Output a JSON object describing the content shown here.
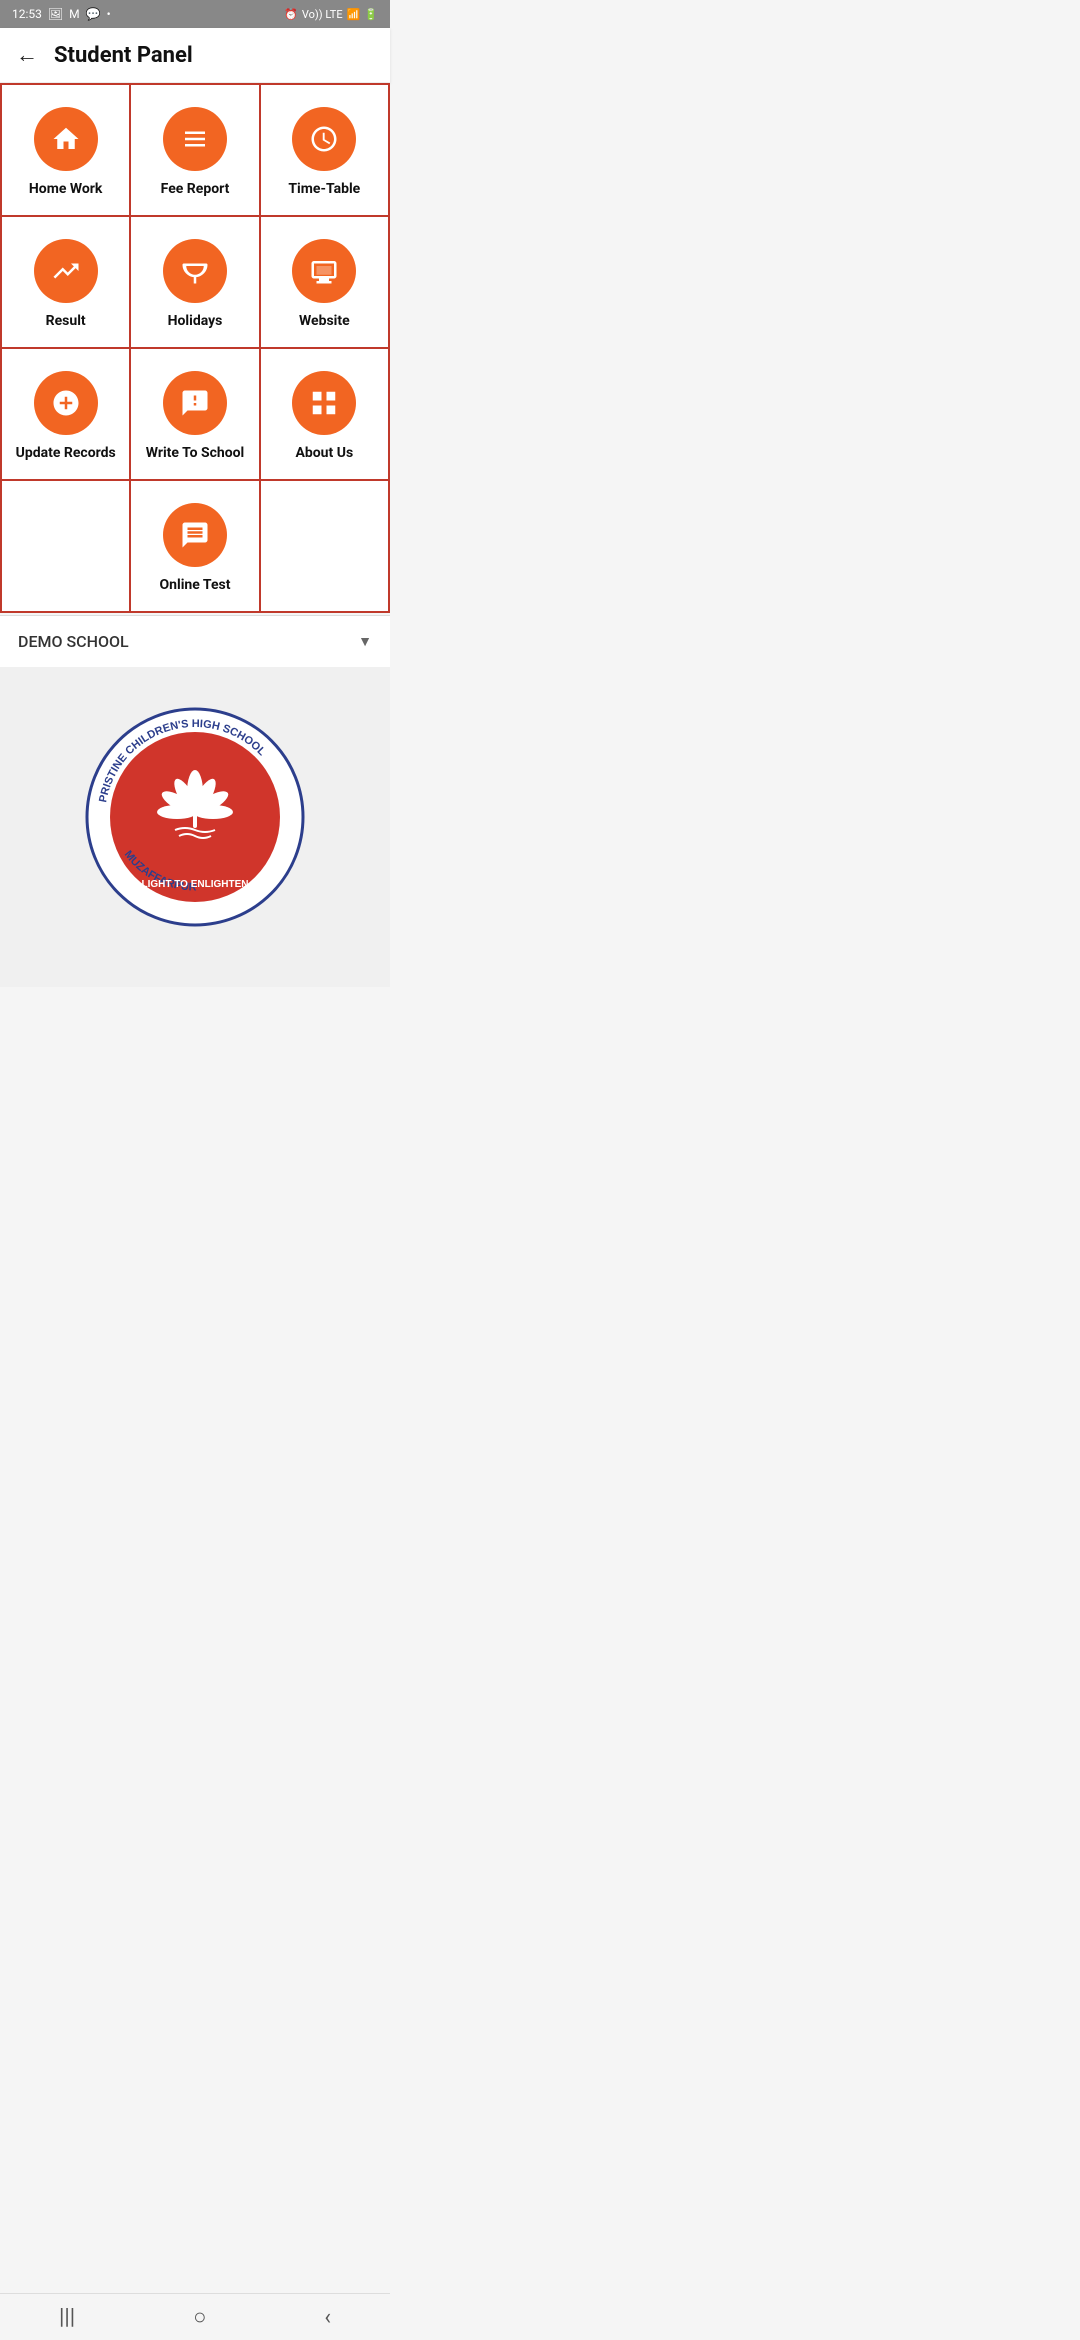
{
  "statusBar": {
    "time": "12:53",
    "rightIcons": "Vo)) LTE"
  },
  "header": {
    "backLabel": "←",
    "title": "Student Panel"
  },
  "grid": {
    "items": [
      {
        "id": "homework",
        "label": "Home Work",
        "icon": "home"
      },
      {
        "id": "feereport",
        "label": "Fee Report",
        "icon": "receipt"
      },
      {
        "id": "timetable",
        "label": "Time-Table",
        "icon": "clock"
      },
      {
        "id": "result",
        "label": "Result",
        "icon": "trending-up"
      },
      {
        "id": "holidays",
        "label": "Holidays",
        "icon": "umbrella"
      },
      {
        "id": "website",
        "label": "Website",
        "icon": "monitor"
      },
      {
        "id": "updaterecords",
        "label": "Update Records",
        "icon": "plus-circle"
      },
      {
        "id": "writeteschool",
        "label": "Write To School",
        "icon": "message-alert"
      },
      {
        "id": "aboutus",
        "label": "About Us",
        "icon": "grid"
      },
      {
        "id": "empty1",
        "label": "",
        "icon": null
      },
      {
        "id": "onlinetest",
        "label": "Online Test",
        "icon": "chat-quiz"
      },
      {
        "id": "empty2",
        "label": "",
        "icon": null
      }
    ]
  },
  "schoolSelector": {
    "name": "DEMO SCHOOL",
    "dropdownLabel": "▼"
  },
  "navBar": {
    "items": [
      "|||",
      "○",
      "<"
    ]
  }
}
